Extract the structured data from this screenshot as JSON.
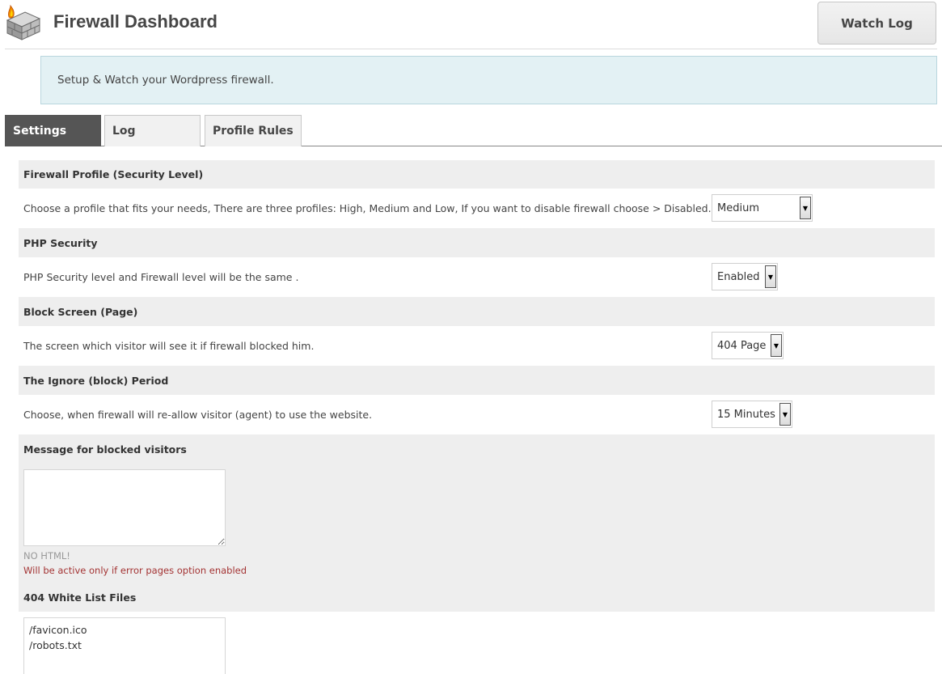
{
  "header": {
    "title": "Firewall Dashboard",
    "watch_log_label": "Watch Log"
  },
  "notice": {
    "text": "Setup & Watch your Wordpress firewall."
  },
  "tabs": [
    {
      "label": "Settings",
      "active": true
    },
    {
      "label": "Log",
      "active": false
    },
    {
      "label": "Profile Rules",
      "active": false
    }
  ],
  "sections": {
    "profile": {
      "heading": "Firewall Profile (Security Level)",
      "description": "Choose a profile that fits your needs, There are three profiles: High, Medium and Low, If you want to disable firewall choose > Disabled.",
      "selected": "Medium"
    },
    "php": {
      "heading": "PHP Security",
      "description": "PHP Security level and Firewall level will be the same .",
      "selected": "Enabled"
    },
    "block_screen": {
      "heading": "Block Screen (Page)",
      "description": "The screen which visitor will see it if firewall blocked him.",
      "selected": "404 Page"
    },
    "ignore_period": {
      "heading": "The Ignore (block) Period",
      "description": "Choose, when firewall will re-allow visitor (agent) to use the website.",
      "selected": "15 Minutes"
    },
    "message": {
      "heading": "Message for blocked visitors",
      "value": "",
      "hint_no_html": "NO HTML!",
      "hint_active": "Will be active only if error pages option enabled"
    },
    "whitelist": {
      "heading": "404 White List Files",
      "value": "/favicon.ico\n/robots.txt"
    }
  },
  "colors": {
    "active_tab": "#555555",
    "notice_bg": "#e3f1f4",
    "section_head_bg": "#eeeeee",
    "warning_text": "#a33333"
  }
}
